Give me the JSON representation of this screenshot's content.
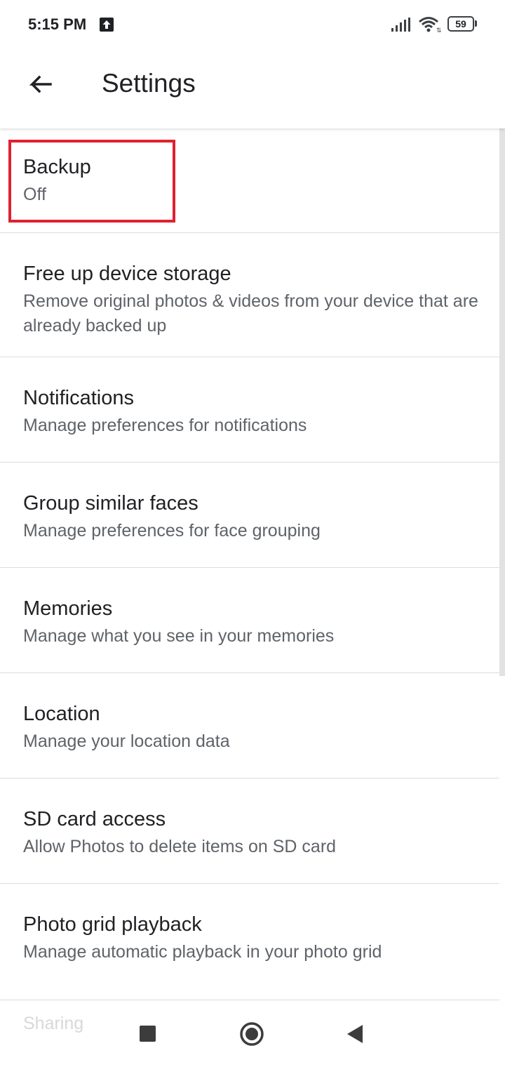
{
  "status_bar": {
    "time": "5:15 PM",
    "battery_level": "59",
    "icons": [
      "upload-icon",
      "signal-icon",
      "wifi-icon",
      "battery-icon"
    ]
  },
  "app_bar": {
    "title": "Settings",
    "back_icon": "arrow-back-icon"
  },
  "settings": [
    {
      "title": "Backup",
      "subtitle": "Off"
    },
    {
      "title": "Free up device storage",
      "subtitle": "Remove original photos & videos from your device that are already backed up"
    },
    {
      "title": "Notifications",
      "subtitle": "Manage preferences for notifications"
    },
    {
      "title": "Group similar faces",
      "subtitle": "Manage preferences for face grouping"
    },
    {
      "title": "Memories",
      "subtitle": "Manage what you see in your memories"
    },
    {
      "title": "Location",
      "subtitle": "Manage your location data"
    },
    {
      "title": "SD card access",
      "subtitle": "Allow Photos to delete items on SD card"
    },
    {
      "title": "Photo grid playback",
      "subtitle": "Manage automatic playback in your photo grid"
    }
  ],
  "partial_item": "Sharing",
  "highlight_color": "#e0212f",
  "nav_bar": {
    "icons": [
      "recents-icon",
      "home-icon",
      "back-icon"
    ]
  }
}
